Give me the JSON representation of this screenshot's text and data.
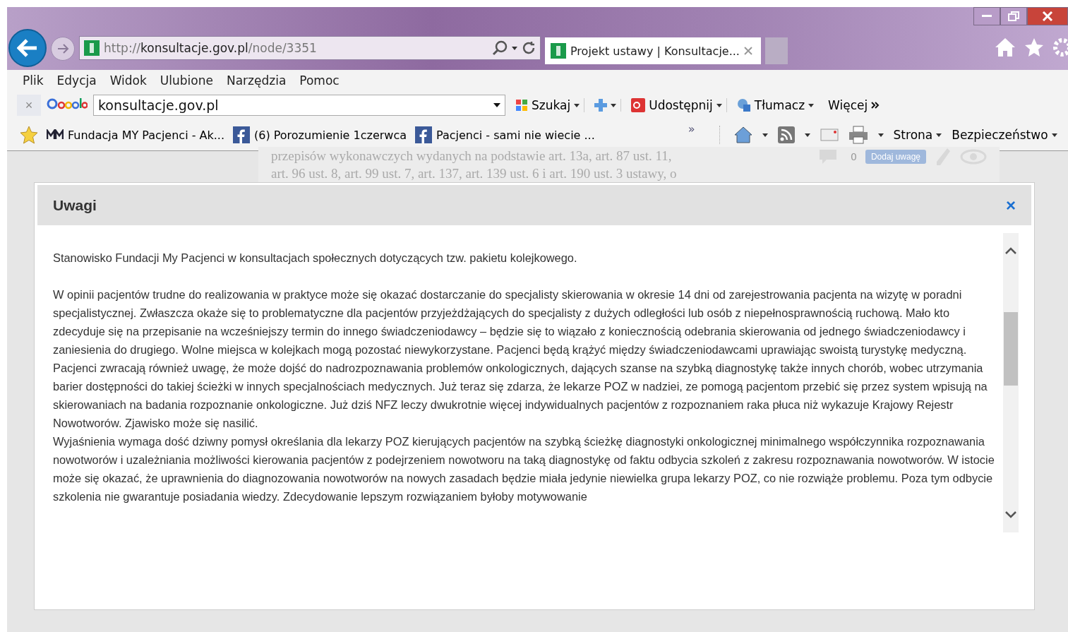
{
  "browser": {
    "address": {
      "prefix": "http://",
      "domain": "konsultacje.gov.pl",
      "path": "/node/3351"
    },
    "tabs": [
      {
        "title": "Projekt ustawy | Konsultacje...",
        "selected": true
      }
    ],
    "menu": [
      "Plik",
      "Edycja",
      "Widok",
      "Ulubione",
      "Narzędzia",
      "Pomoc"
    ],
    "google_toolbar": {
      "close": "×",
      "search_value": "konsultacje.gov.pl",
      "items": [
        {
          "kind": "search",
          "label": "Szukaj"
        },
        {
          "kind": "plus"
        },
        {
          "kind": "share",
          "label": "Udostępnij"
        },
        {
          "kind": "translate",
          "label": "Tłumacz"
        },
        {
          "kind": "more",
          "label": "Więcej"
        }
      ]
    },
    "favorites": [
      {
        "kind": "mm",
        "label": "Fundacja MY Pacjenci - Ak..."
      },
      {
        "kind": "fb",
        "label": "(6) Porozumienie 1czerwca"
      },
      {
        "kind": "fb",
        "label": "Pacjenci - sami nie wiecie ..."
      }
    ],
    "overflow": "»",
    "command_bar": [
      "Strona",
      "Bezpieczeństwo"
    ]
  },
  "background_page": {
    "lines": [
      "przepisów wykonawczych wydanych na podstawie art. 13a, art. 87 ust. 11,",
      "art. 96 ust. 8, art. 99 ust. 7, art. 137, art. 139 ust. 6 i art. 190 ust. 3 ustawy, o"
    ],
    "count": "0",
    "add_button": "Dodaj uwagę"
  },
  "dialog": {
    "title": "Uwagi",
    "close": "×",
    "paragraphs": [
      "Stanowisko Fundacji My Pacjenci w konsultacjach społecznych dotyczących tzw. pakietu kolejkowego.",
      "W opinii pacjentów trudne do realizowania w praktyce może się okazać dostarczanie do specjalisty skierowania w okresie 14 dni od zarejestrowania pacjenta na wizytę w poradni specjalistycznej. Zwłaszcza okaże się to problematyczne dla pacjentów przyjeżdżających do specjalisty z dużych odległości lub osób z niepełnosprawnością ruchową. Mało kto zdecyduje się na przepisanie na wcześniejszy termin do innego świadczeniodawcy – będzie się to wiązało z koniecznością odebrania skierowania od jednego świadczeniodawcy i zaniesienia do drugiego. Wolne miejsca w kolejkach mogą pozostać niewykorzystane. Pacjenci będą krążyć między świadczeniodawcami uprawiając swoistą turystykę medyczną.",
      "Pacjenci zwracają również uwagę, że może dojść do nadrozpoznawania problemów onkologicznych, dających szanse na szybką diagnostykę także innych chorób, wobec utrzymania barier dostępności do takiej ścieżki w innych specjalnościach medycznych. Już teraz się zdarza, że lekarze POZ w nadziei, ze pomogą pacjentom przebić się przez system wpisują na skierowaniach na badania rozpoznanie onkologiczne. Już dziś NFZ leczy dwukrotnie więcej indywidualnych pacjentów z rozpoznaniem raka płuca niż wykazuje Krajowy Rejestr Nowotworów. Zjawisko może się nasilić.",
      "Wyjaśnienia wymaga dość dziwny pomysł określania dla lekarzy POZ kierujących pacjentów na szybką ścieżkę diagnostyki onkologicznej minimalnego współczynnika rozpoznawania nowotworów i uzależniania możliwości kierowania pacjentów z podejrzeniem nowotworu na taką diagnostykę od faktu odbycia szkoleń z zakresu rozpoznawania nowotworów. W istocie może się okazać, że uprawnienia do diagnozowania nowotworów na nowych zasadach będzie miała jedynie niewielka grupa lekarzy POZ, co nie rozwiąże problemu. Poza tym odbycie szkolenia nie gwarantuje posiadania wiedzy. Zdecydowanie lepszym rozwiązaniem byłoby motywowanie"
    ]
  }
}
